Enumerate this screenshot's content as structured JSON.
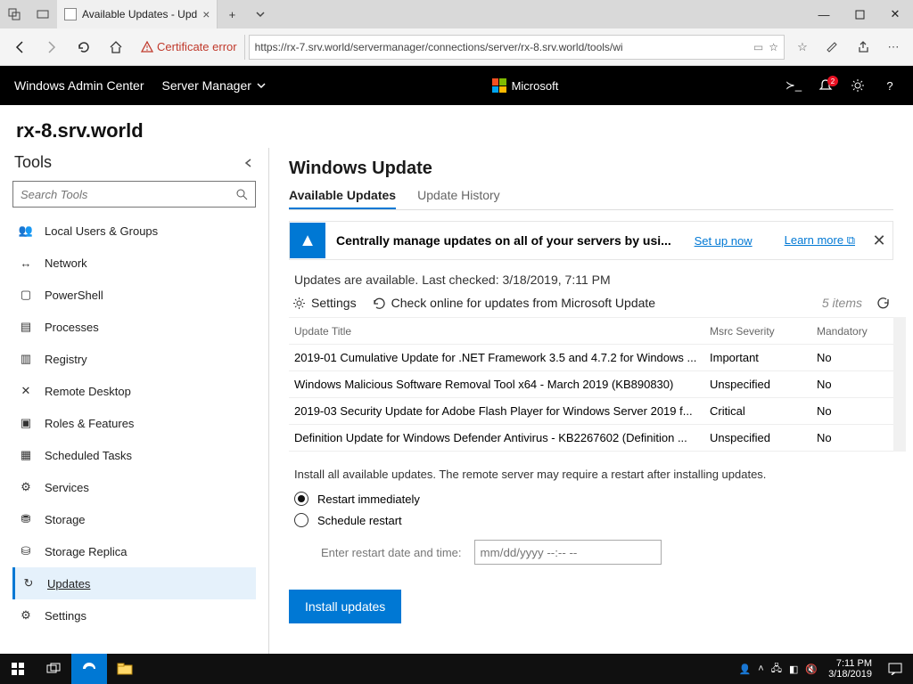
{
  "browser": {
    "tab_title": "Available Updates - Upd",
    "cert_error": "Certificate error",
    "url": "https://rx-7.srv.world/servermanager/connections/server/rx-8.srv.world/tools/wi"
  },
  "wac": {
    "brand": "Windows Admin Center",
    "server_manager": "Server Manager",
    "ms_label": "Microsoft",
    "notif_count": "2"
  },
  "server": "rx-8.srv.world",
  "tools": {
    "heading": "Tools",
    "search_placeholder": "Search Tools",
    "items": [
      {
        "label": "Local Users & Groups",
        "icon": "users"
      },
      {
        "label": "Network",
        "icon": "network"
      },
      {
        "label": "PowerShell",
        "icon": "terminal"
      },
      {
        "label": "Processes",
        "icon": "processes"
      },
      {
        "label": "Registry",
        "icon": "registry"
      },
      {
        "label": "Remote Desktop",
        "icon": "remote"
      },
      {
        "label": "Roles & Features",
        "icon": "roles"
      },
      {
        "label": "Scheduled Tasks",
        "icon": "tasks"
      },
      {
        "label": "Services",
        "icon": "services"
      },
      {
        "label": "Storage",
        "icon": "storage"
      },
      {
        "label": "Storage Replica",
        "icon": "replica"
      },
      {
        "label": "Updates",
        "icon": "updates",
        "active": true
      },
      {
        "label": "Settings",
        "icon": "settings"
      }
    ]
  },
  "page": {
    "title": "Windows Update",
    "tab_available": "Available Updates",
    "tab_history": "Update History",
    "notice_msg": "Centrally manage updates on all of your servers by usi...",
    "setup_now": "Set up now",
    "learn_more": "Learn more",
    "status": "Updates are available. Last checked: 3/18/2019, 7:11 PM",
    "settings_label": "Settings",
    "check_label": "Check online for updates from Microsoft Update",
    "item_count": "5 items",
    "columns": {
      "title": "Update Title",
      "sev": "Msrc Severity",
      "mand": "Mandatory"
    },
    "rows": [
      {
        "title": "2019-01 Cumulative Update for .NET Framework 3.5 and 4.7.2 for Windows ...",
        "sev": "Important",
        "mand": "No"
      },
      {
        "title": "Windows Malicious Software Removal Tool x64 - March 2019 (KB890830)",
        "sev": "Unspecified",
        "mand": "No"
      },
      {
        "title": "2019-03 Security Update for Adobe Flash Player for Windows Server 2019 f...",
        "sev": "Critical",
        "mand": "No"
      },
      {
        "title": "Definition Update for Windows Defender Antivirus - KB2267602 (Definition ...",
        "sev": "Unspecified",
        "mand": "No"
      }
    ],
    "install_note": "Install all available updates. The remote server may require a restart after installing updates.",
    "radio_now": "Restart immediately",
    "radio_sched": "Schedule restart",
    "dt_label": "Enter restart date and time:",
    "dt_placeholder": "mm/dd/yyyy --:-- --",
    "install_btn": "Install updates"
  },
  "taskbar": {
    "time": "7:11 PM",
    "date": "3/18/2019"
  }
}
